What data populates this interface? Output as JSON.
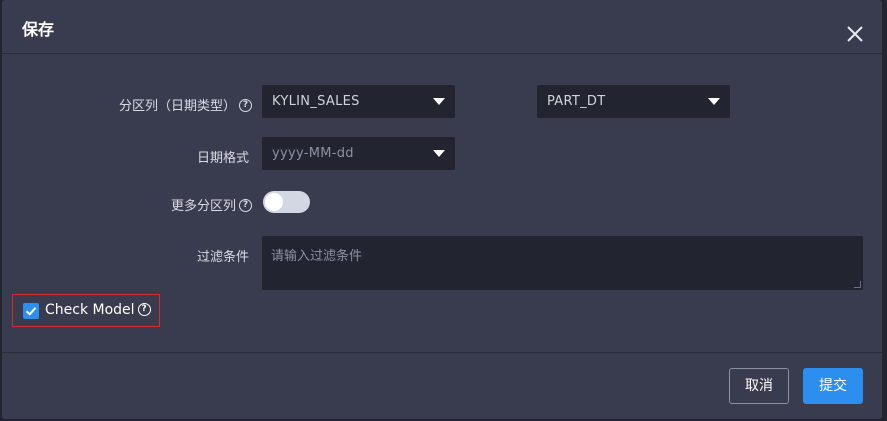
{
  "dialog": {
    "title": "保存",
    "close_icon": "close-icon"
  },
  "form": {
    "partition_label": "分区列（日期类型）",
    "partition_table": "KYLIN_SALES",
    "partition_column": "PART_DT",
    "date_format_label": "日期格式",
    "date_format_placeholder": "yyyy-MM-dd",
    "more_partition_label": "更多分区列",
    "more_partition_enabled": false,
    "filter_label": "过滤条件",
    "filter_placeholder": "请输入过滤条件",
    "check_model_label": "Check Model",
    "check_model_checked": true,
    "help_icon_glyph": "?"
  },
  "footer": {
    "cancel_label": "取消",
    "submit_label": "提交"
  },
  "colors": {
    "dialog_bg": "#393c4e",
    "input_bg": "#22242f",
    "primary": "#2c8ff0",
    "highlight_border": "#d0302a"
  }
}
